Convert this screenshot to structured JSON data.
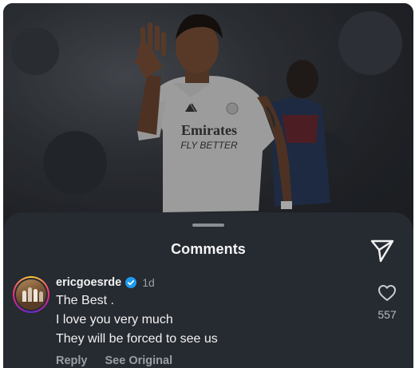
{
  "sheet": {
    "title": "Comments"
  },
  "comment": {
    "username": "ericgoesrde",
    "verified": true,
    "time": "1d",
    "lines": [
      "The Best .",
      "I love you very much",
      "They will be forced to see us"
    ],
    "actions": {
      "reply": "Reply",
      "see_original": "See Original"
    },
    "like_count": "557"
  },
  "icons": {
    "share": "paper-plane-icon",
    "verified": "verified-badge-icon",
    "like": "heart-outline-icon"
  },
  "colors": {
    "sheet_bg": "#262a31",
    "verified_blue": "#1d9bf0",
    "muted_text": "#9a9ea6"
  },
  "photo": {
    "jersey_sponsor": "Emirates",
    "jersey_tagline": "FLY BETTER"
  }
}
